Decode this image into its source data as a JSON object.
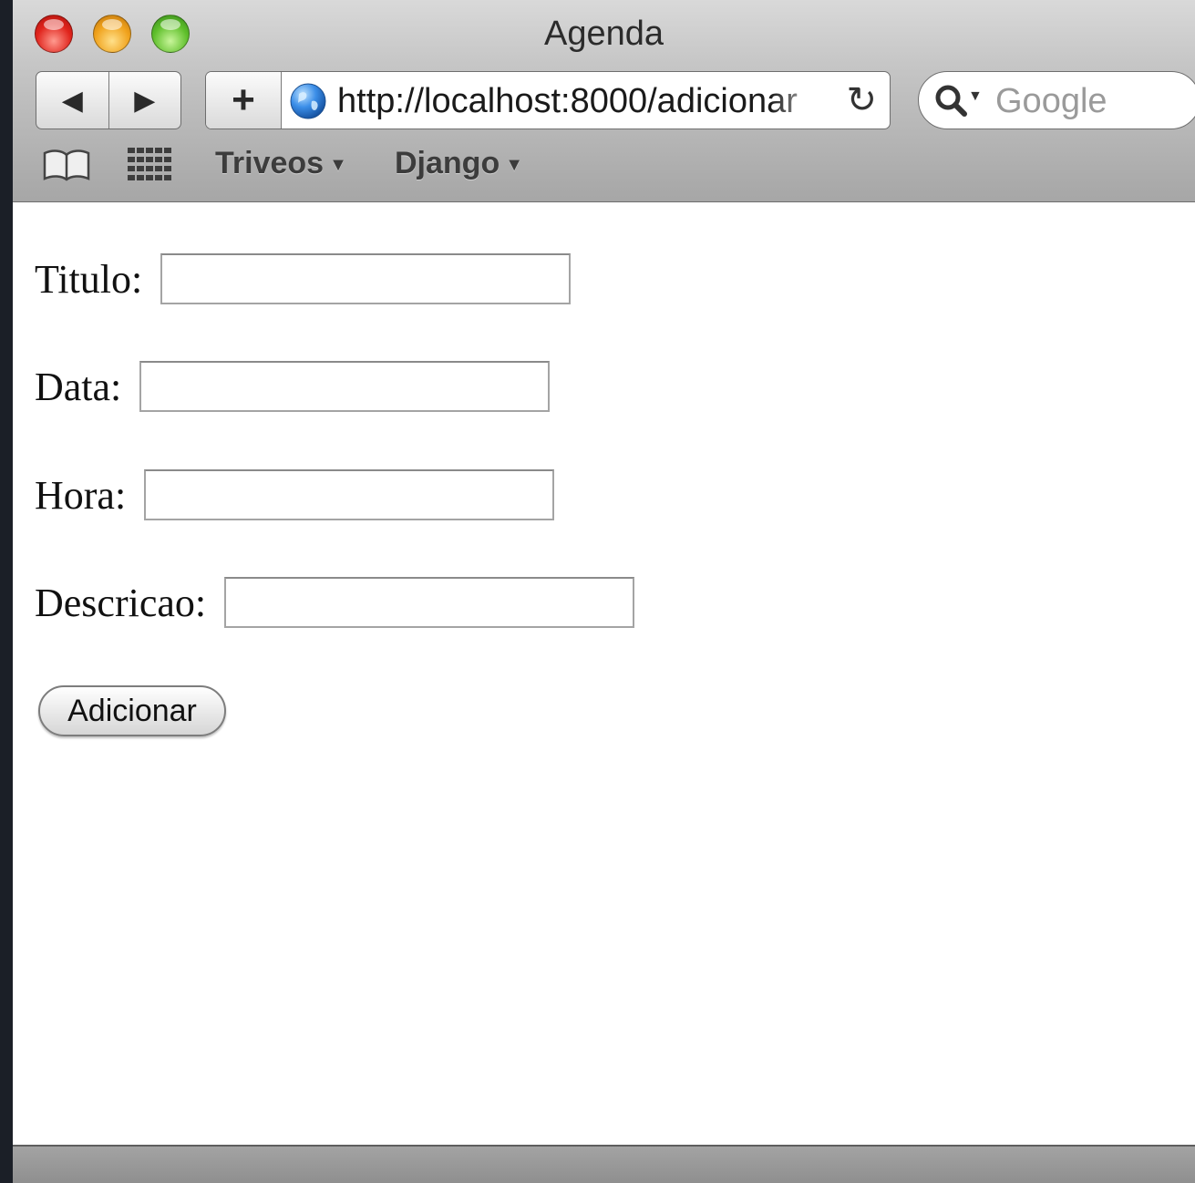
{
  "window": {
    "title": "Agenda"
  },
  "toolbar": {
    "back_icon": "◀",
    "forward_icon": "▶",
    "add_icon": "+",
    "url": "http://localhost:8000/adicionar",
    "reload_icon": "↻",
    "search_placeholder": "Google"
  },
  "bookmarks": {
    "items": [
      {
        "label": "Triveos"
      },
      {
        "label": "Django"
      }
    ],
    "arrow": "▼"
  },
  "form": {
    "fields": [
      {
        "label": "Titulo:",
        "value": ""
      },
      {
        "label": "Data:",
        "value": ""
      },
      {
        "label": "Hora:",
        "value": ""
      },
      {
        "label": "Descricao:",
        "value": ""
      }
    ],
    "submit_label": "Adicionar"
  }
}
